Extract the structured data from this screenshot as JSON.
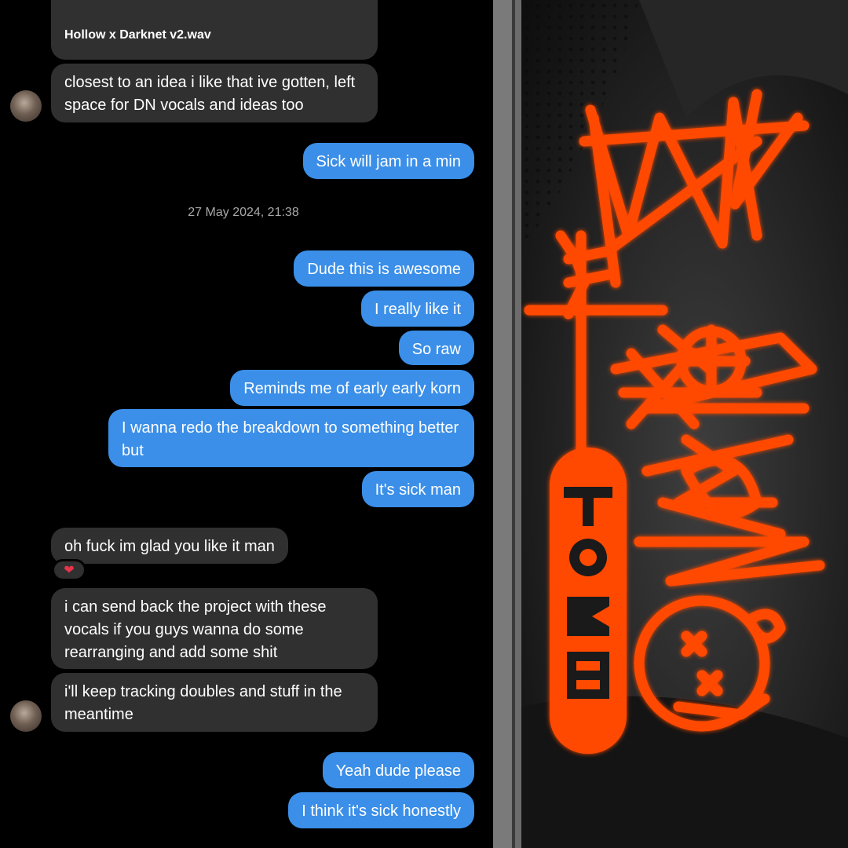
{
  "chat": {
    "file_attachment": {
      "name": "Hollow x Darknet v2.wav"
    },
    "timestamp": "27 May 2024, 21:38",
    "messages": [
      {
        "dir": "in",
        "text": "closest to an idea i like that ive gotten, left space for DN vocals and ideas too"
      },
      {
        "dir": "out",
        "text": "Sick will jam in a min"
      },
      {
        "dir": "out",
        "text": "Dude this is awesome"
      },
      {
        "dir": "out",
        "text": "I really like it"
      },
      {
        "dir": "out",
        "text": "So raw"
      },
      {
        "dir": "out",
        "text": "Reminds me of early early korn"
      },
      {
        "dir": "out",
        "text": "I wanna redo the breakdown to something better but"
      },
      {
        "dir": "out",
        "text": "It's sick man"
      },
      {
        "dir": "in",
        "text": "oh fuck im glad you like it man"
      },
      {
        "dir": "in",
        "text": "i can send back the project with these vocals if you guys wanna do some rearranging and add some shit"
      },
      {
        "dir": "in",
        "text": "i'll keep tracking doubles and stuff in the meantime"
      },
      {
        "dir": "out",
        "text": "Yeah dude please"
      },
      {
        "dir": "out",
        "text": "I think it's sick honestly"
      }
    ],
    "reaction": {
      "icon": "heart-icon",
      "glyph": "❤"
    }
  },
  "colors": {
    "incoming_bubble": "#303030",
    "outgoing_bubble": "#3b8fe8",
    "artwork_accent": "#ff4a00"
  },
  "artwork": {
    "logo_text": "TOMB"
  }
}
